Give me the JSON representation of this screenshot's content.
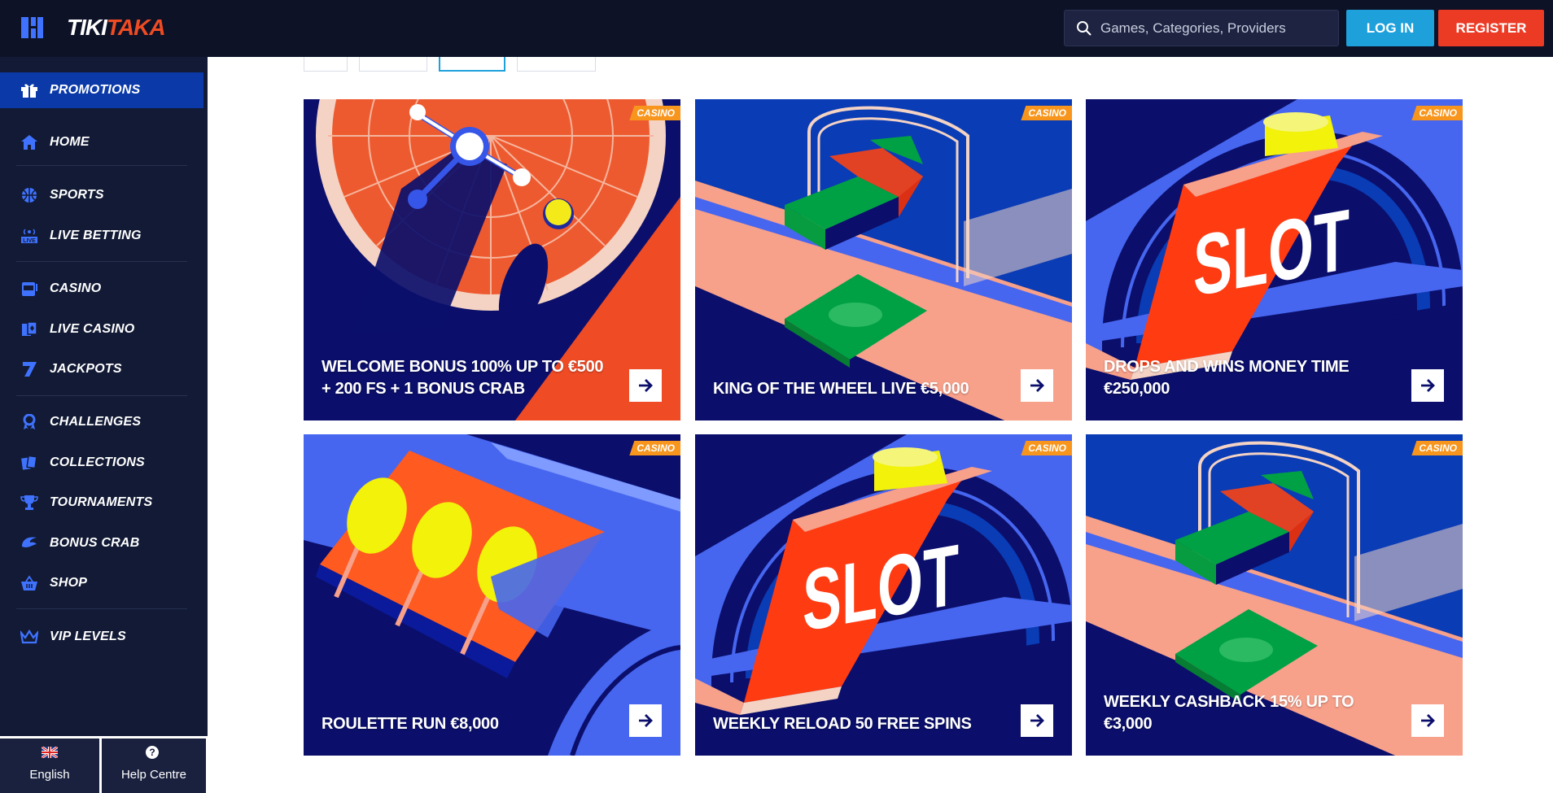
{
  "header": {
    "brand_part1": "TIKI",
    "brand_part2": "TAKA",
    "search_placeholder": "Games, Categories, Providers",
    "login_label": "LOG IN",
    "register_label": "REGISTER"
  },
  "sidebar": {
    "items": [
      {
        "label": "PROMOTIONS",
        "icon": "gift-icon"
      },
      {
        "label": "HOME",
        "icon": "home-icon"
      },
      {
        "label": "SPORTS",
        "icon": "basketball-icon"
      },
      {
        "label": "LIVE BETTING",
        "icon": "live-icon"
      },
      {
        "label": "CASINO",
        "icon": "slot-machine-icon"
      },
      {
        "label": "LIVE CASINO",
        "icon": "cards-icon"
      },
      {
        "label": "JACKPOTS",
        "icon": "seven-icon"
      },
      {
        "label": "CHALLENGES",
        "icon": "medal-icon"
      },
      {
        "label": "COLLECTIONS",
        "icon": "collection-cards-icon"
      },
      {
        "label": "TOURNAMENTS",
        "icon": "trophy-icon"
      },
      {
        "label": "BONUS CRAB",
        "icon": "crab-claw-icon"
      },
      {
        "label": "SHOP",
        "icon": "basket-icon"
      },
      {
        "label": "VIP LEVELS",
        "icon": "crown-icon"
      }
    ],
    "language_label": "English",
    "help_label": "Help Centre",
    "help_glyph": "?"
  },
  "promotions": [
    {
      "title": "WELCOME BONUS 100% UP TO €500 + 200 FS + 1 BONUS CRAB",
      "badge": "CASINO",
      "art": "roulette-wheel"
    },
    {
      "title": "KING OF THE WHEEL LIVE €5,000",
      "badge": "CASINO",
      "art": "money-conveyor"
    },
    {
      "title": "DROPS AND WINS MONEY TIME €250,000",
      "badge": "CASINO",
      "art": "slot-arch"
    },
    {
      "title": "ROULETTE RUN €8,000",
      "badge": "CASINO",
      "art": "lemon-reels"
    },
    {
      "title": "WEEKLY RELOAD 50 FREE SPINS",
      "badge": "CASINO",
      "art": "slot-arch"
    },
    {
      "title": "WEEKLY CASHBACK 15% UP TO €3,000",
      "badge": "CASINO",
      "art": "money-conveyor"
    }
  ],
  "slot_text": "SLOT",
  "colors": {
    "topbar": "#0d1227",
    "sidebar": "#121a35",
    "active_item": "#0b3aa8",
    "login": "#1ea0db",
    "register": "#ec3b25",
    "badge": "#f7951d",
    "card_navy": "#0b0f6b",
    "card_blue": "#4666f0",
    "card_orange": "#ef4b25"
  }
}
